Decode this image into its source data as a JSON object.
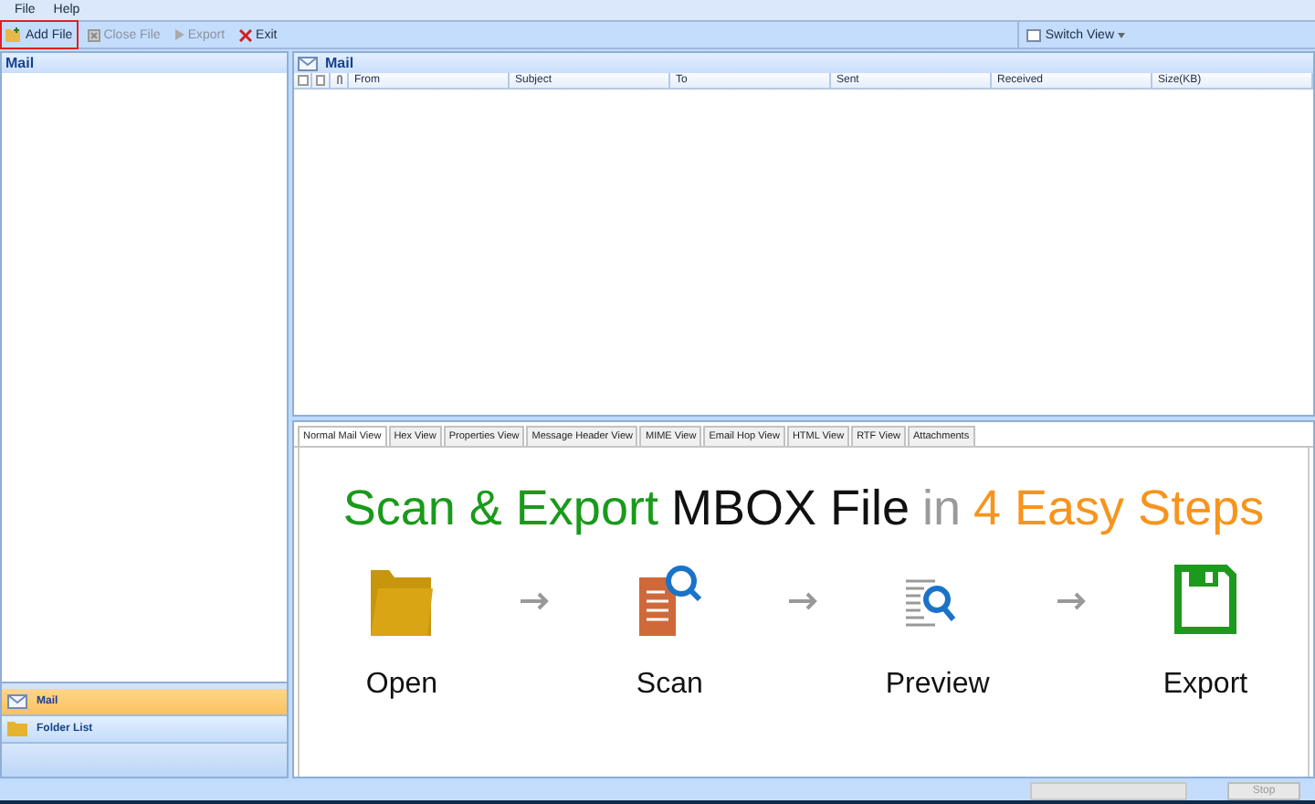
{
  "menu": [
    "File",
    "Help"
  ],
  "toolbar": [
    {
      "label": "Add File",
      "kind": "add",
      "disabled": false,
      "highlighted": true
    },
    {
      "label": "Close File",
      "kind": "close",
      "disabled": true,
      "highlighted": false
    },
    {
      "label": "Export",
      "kind": "export",
      "disabled": true,
      "highlighted": false
    },
    {
      "label": "Exit",
      "kind": "exit",
      "disabled": false,
      "highlighted": false
    }
  ],
  "switch_view": "Switch View",
  "left_pane": {
    "title": "Mail"
  },
  "nav": [
    {
      "label": "Mail",
      "kind": "mail",
      "selected": true
    },
    {
      "label": "Folder List",
      "kind": "folder",
      "selected": false
    }
  ],
  "mail_pane": {
    "title": "Mail",
    "columns": [
      "From",
      "Subject",
      "To",
      "Sent",
      "Received",
      "Size(KB)"
    ]
  },
  "tabs": [
    {
      "label": "Normal Mail View",
      "selected": true
    },
    {
      "label": "Hex View",
      "selected": false
    },
    {
      "label": "Properties View",
      "selected": false
    },
    {
      "label": "Message Header View",
      "selected": false
    },
    {
      "label": "MIME View",
      "selected": false
    },
    {
      "label": "Email Hop View",
      "selected": false
    },
    {
      "label": "HTML View",
      "selected": false
    },
    {
      "label": "RTF View",
      "selected": false
    },
    {
      "label": "Attachments",
      "selected": false
    }
  ],
  "banner": {
    "headline": [
      {
        "text": "Scan & Export",
        "color": "#1a9a1a"
      },
      {
        "text": "MBOX File",
        "color": "#111111"
      },
      {
        "text": "in",
        "color": "#9a9a9a"
      },
      {
        "text": "4 Easy Steps",
        "color": "#f7941d"
      }
    ],
    "steps": [
      {
        "label": "Open",
        "kind": "folder"
      },
      {
        "label": "Scan",
        "kind": "scan"
      },
      {
        "label": "Preview",
        "kind": "preview"
      },
      {
        "label": "Export",
        "kind": "save"
      }
    ]
  },
  "status_bar": {
    "progress": {
      "level": 0
    },
    "stop": "Stop",
    "stop_disabled": true
  }
}
